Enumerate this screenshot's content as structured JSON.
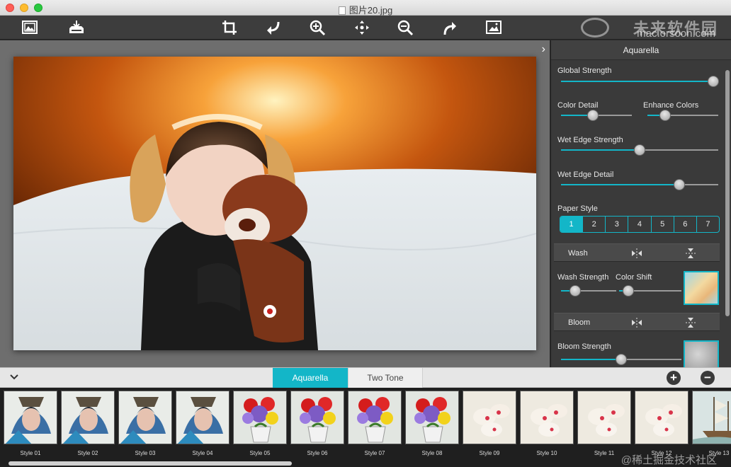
{
  "window": {
    "title": "图片20.jpg"
  },
  "toolbar": {
    "buttons": [
      {
        "name": "open-image-icon"
      },
      {
        "name": "save-image-icon"
      },
      {
        "name": "crop-icon"
      },
      {
        "name": "rotate-left-icon"
      },
      {
        "name": "zoom-in-icon"
      },
      {
        "name": "fit-move-icon"
      },
      {
        "name": "zoom-out-icon"
      },
      {
        "name": "rotate-right-icon"
      },
      {
        "name": "compare-image-icon"
      }
    ],
    "watermark_big": "未来软件园",
    "watermark_small": "mac.orsoon.com"
  },
  "panel": {
    "title": "Aquarella",
    "global_strength_label": "Global Strength",
    "global_strength": 1.0,
    "color_detail_label": "Color Detail",
    "color_detail": 0.45,
    "enhance_colors_label": "Enhance Colors",
    "enhance_colors": 0.25,
    "wet_edge_strength_label": "Wet Edge Strength",
    "wet_edge_strength": 0.5,
    "wet_edge_detail_label": "Wet Edge Detail",
    "wet_edge_detail": 0.75,
    "paper_style_label": "Paper Style",
    "paper_styles": [
      "1",
      "2",
      "3",
      "4",
      "5",
      "6",
      "7"
    ],
    "paper_style_selected": "1",
    "wash_label": "Wash",
    "wash_strength_label": "Wash Strength",
    "wash_strength": 0.25,
    "color_shift_label": "Color Shift",
    "color_shift": 0.15,
    "bloom_label": "Bloom",
    "bloom_strength_label": "Bloom Strength",
    "bloom_strength": 0.5
  },
  "tabs": [
    {
      "label": "Aquarella",
      "active": true
    },
    {
      "label": "Two Tone",
      "active": false
    }
  ],
  "styles": [
    {
      "label": "Style 01",
      "kind": "portrait"
    },
    {
      "label": "Style 02",
      "kind": "portrait"
    },
    {
      "label": "Style 03",
      "kind": "portrait"
    },
    {
      "label": "Style 04",
      "kind": "portrait"
    },
    {
      "label": "Style 05",
      "kind": "flowers"
    },
    {
      "label": "Style 06",
      "kind": "flowers"
    },
    {
      "label": "Style 07",
      "kind": "flowers"
    },
    {
      "label": "Style 08",
      "kind": "flowers"
    },
    {
      "label": "Style 09",
      "kind": "orchid"
    },
    {
      "label": "Style 10",
      "kind": "orchid"
    },
    {
      "label": "Style 11",
      "kind": "orchid"
    },
    {
      "label": "Style 12",
      "kind": "orchid"
    },
    {
      "label": "Style 13",
      "kind": "ship"
    }
  ],
  "bottom_watermark": "@稀土掘金技术社区",
  "colors": {
    "accent": "#13b6c8",
    "panel_bg": "#3a3a3a",
    "toolbar_bg": "#3d3d3d"
  }
}
